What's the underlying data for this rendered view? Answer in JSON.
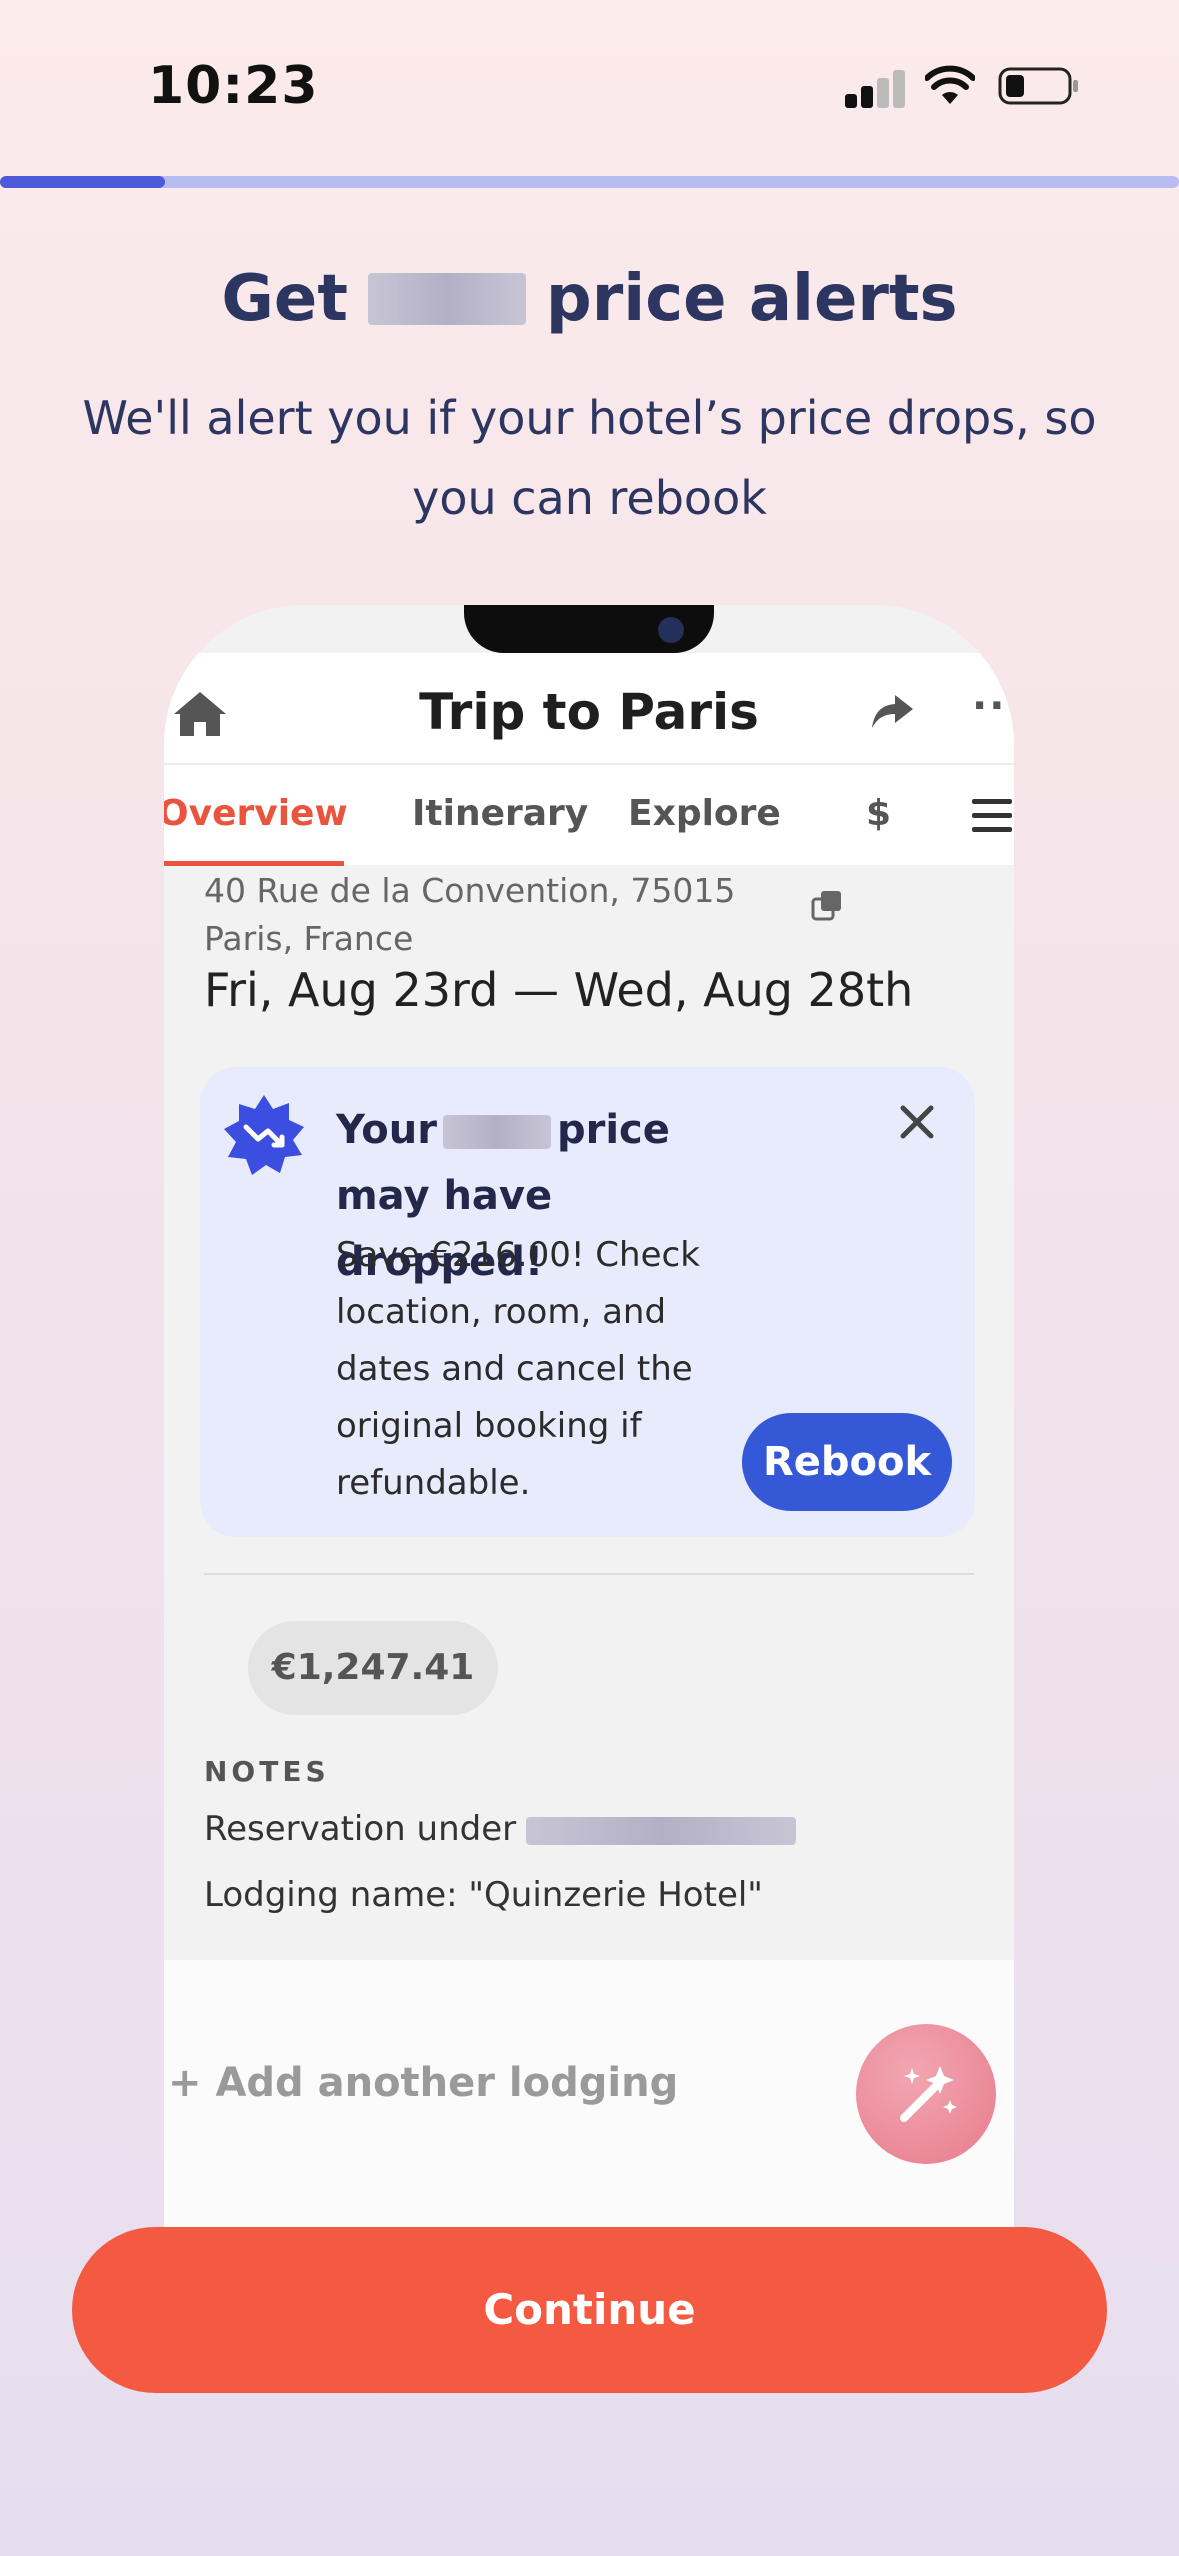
{
  "status_bar": {
    "time": "10:23"
  },
  "progress": {
    "fraction": 0.14
  },
  "header": {
    "title_before": "Get",
    "title_after": "price alerts",
    "subtitle": "We'll alert you if your hotel’s price drops, so you can rebook"
  },
  "mock_app": {
    "title": "Trip to Paris",
    "tabs": [
      "Overview",
      "Itinerary",
      "Explore",
      "$"
    ],
    "address": "40 Rue de la Convention, 75015 Paris, France",
    "dates": "Fri, Aug 23rd — Wed, Aug 28th",
    "alert": {
      "title_before": "Your",
      "title_after": "price",
      "title_line2": "may have dropped!",
      "body": "Save €216.00! Check location, room, and dates and cancel the original booking if refundable.",
      "button": "Rebook"
    },
    "price": "€1,247.41",
    "notes_label": "NOTES",
    "notes_reservation": "Reservation under",
    "notes_lodging": "Lodging name: \"Quinzerie Hotel\"",
    "add_lodging": "Add another lodging"
  },
  "footer": {
    "continue_label": "Continue"
  },
  "colors": {
    "accent": "#f45a42",
    "progress": "#4d5ad9",
    "rebook": "#3559d6"
  }
}
